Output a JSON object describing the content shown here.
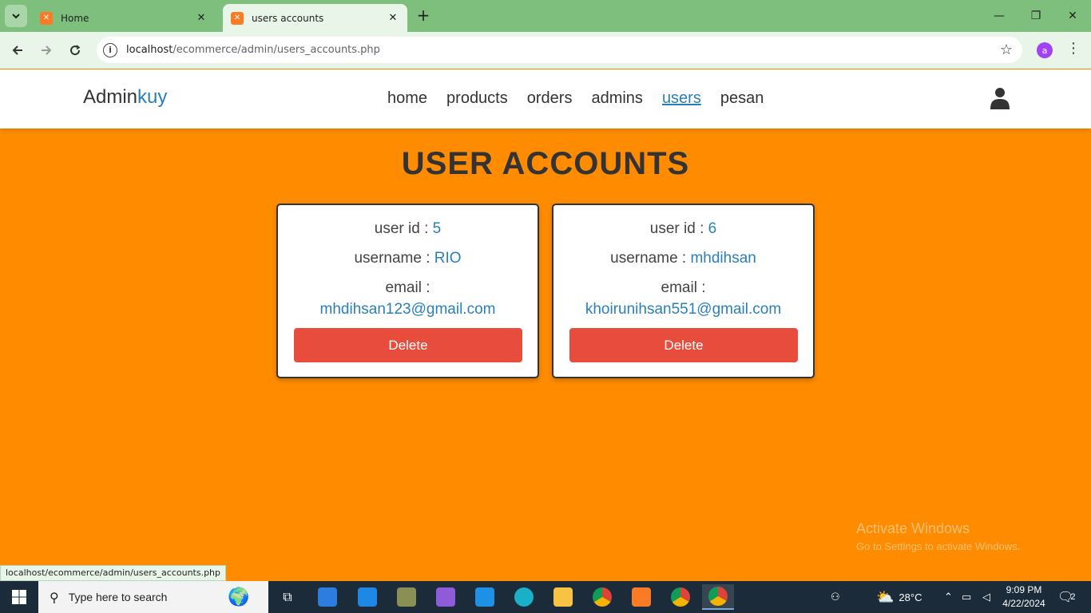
{
  "browser": {
    "tabs": [
      {
        "title": "Home",
        "active": false
      },
      {
        "title": "users accounts",
        "active": true
      }
    ],
    "url_host": "localhost",
    "url_path": "/ecommerce/admin/users_accounts.php",
    "profile_initial": "a",
    "status_url": "localhost/ecommerce/admin/users_accounts.php"
  },
  "site": {
    "logo_main": "Admin",
    "logo_accent": "kuy",
    "nav": [
      {
        "label": "home",
        "active": false
      },
      {
        "label": "products",
        "active": false
      },
      {
        "label": "orders",
        "active": false
      },
      {
        "label": "admins",
        "active": false
      },
      {
        "label": "users",
        "active": true
      },
      {
        "label": "pesan",
        "active": false
      }
    ]
  },
  "main": {
    "title": "USER ACCOUNTS",
    "user_id_label": "user id : ",
    "username_label": "username : ",
    "email_label": "email :",
    "delete_label": "Delete",
    "users": [
      {
        "id": "5",
        "username": "RIO",
        "email": "mhdihsan123@gmail.com"
      },
      {
        "id": "6",
        "username": "mhdihsan",
        "email": "khoirunihsan551@gmail.com"
      }
    ]
  },
  "watermark": {
    "line1": "Activate Windows",
    "line2": "Go to Settings to activate Windows."
  },
  "taskbar": {
    "search_placeholder": "Type here to search",
    "weather": "28°C",
    "time": "9:09 PM",
    "date": "4/22/2024",
    "notification_count": "2"
  },
  "colors": {
    "page_bg": "#ff8c00",
    "accent": "#2980b9",
    "delete": "#e74c3c",
    "chrome_green": "#7ebf7e"
  }
}
